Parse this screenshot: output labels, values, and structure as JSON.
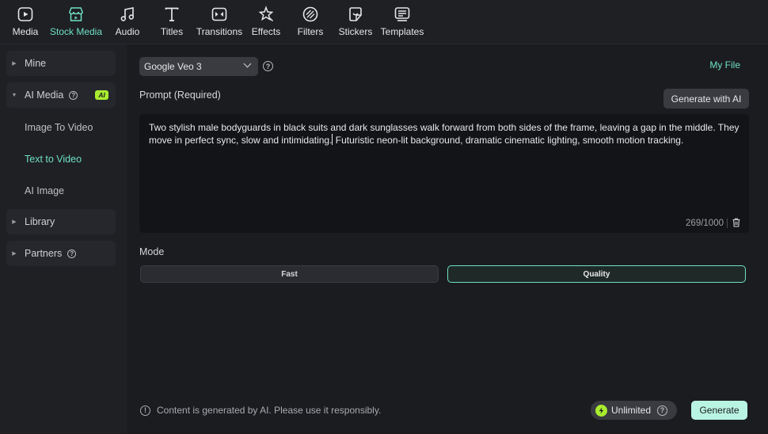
{
  "toolbar": {
    "items": [
      {
        "label": "Media",
        "icon": "media-icon"
      },
      {
        "label": "Stock Media",
        "icon": "stock-media-icon"
      },
      {
        "label": "Audio",
        "icon": "audio-icon"
      },
      {
        "label": "Titles",
        "icon": "titles-icon"
      },
      {
        "label": "Transitions",
        "icon": "transitions-icon"
      },
      {
        "label": "Effects",
        "icon": "effects-icon"
      },
      {
        "label": "Filters",
        "icon": "filters-icon"
      },
      {
        "label": "Stickers",
        "icon": "stickers-icon"
      },
      {
        "label": "Templates",
        "icon": "templates-icon"
      }
    ],
    "active": "Stock Media"
  },
  "sidebar": {
    "mine": "Mine",
    "ai_media": "AI Media",
    "ai_badge": "AI",
    "sub_items": [
      "Image To Video",
      "Text to Video",
      "AI Image"
    ],
    "active_sub": "Text to Video",
    "library": "Library",
    "partners": "Partners"
  },
  "main": {
    "model": "Google Veo 3",
    "my_file": "My File",
    "prompt_label": "Prompt (Required)",
    "generate_with_ai": "Generate with AI",
    "prompt_before_caret": "Two stylish male bodyguards in black suits and dark sunglasses walk forward from both sides of the frame, leaving a gap in the middle. They move in perfect sync, slow and intimidating.",
    "prompt_after_caret": " Futuristic neon-lit background, dramatic cinematic lighting, smooth motion tracking.",
    "counter": "269/1000",
    "mode_label": "Mode",
    "mode_fast": "Fast",
    "mode_quality": "Quality",
    "selected_mode": "Quality",
    "footer_note": "Content is generated by AI. Please use it responsibly.",
    "unlimited": "Unlimited",
    "generate": "Generate"
  },
  "colors": {
    "accent": "#6fe0c4",
    "ai_badge": "#a9ec2f",
    "generate_button": "#b9f4e2"
  }
}
